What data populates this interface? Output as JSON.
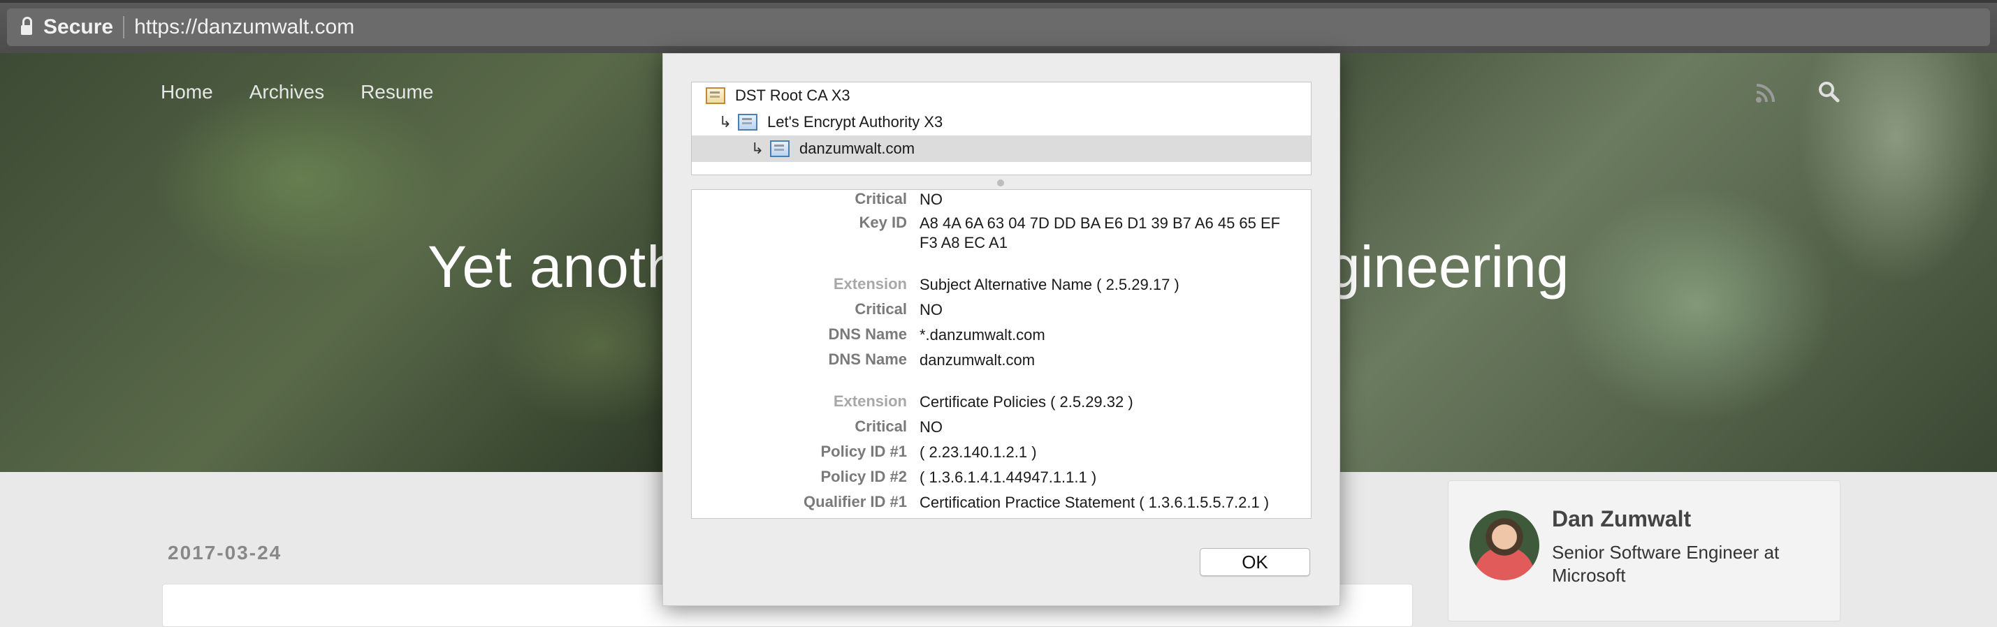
{
  "address_bar": {
    "secure_label": "Secure",
    "url": "https://danzumwalt.com"
  },
  "site": {
    "nav": [
      "Home",
      "Archives",
      "Resume"
    ],
    "headline_left": "Yet anoth",
    "headline_right": "gineering",
    "post_date": "2017-03-24",
    "profile": {
      "name": "Dan Zumwalt",
      "title": "Senior Software Engineer at Microsoft"
    }
  },
  "cert_dialog": {
    "chain": [
      {
        "label": "DST Root CA X3",
        "icon": "cert-root-icon"
      },
      {
        "label": "Let's Encrypt Authority X3",
        "icon": "cert-intermediate-icon"
      },
      {
        "label": "danzumwalt.com",
        "icon": "cert-leaf-icon",
        "selected": true
      }
    ],
    "details": [
      {
        "label": "Critical",
        "value": "NO"
      },
      {
        "label": "Key ID",
        "value": "A8 4A 6A 63 04 7D DD BA E6 D1 39 B7 A6 45 65 EF F3 A8 EC A1"
      },
      {
        "label": "Extension",
        "value": "Subject Alternative Name ( 2.5.29.17 )"
      },
      {
        "label": "Critical",
        "value": "NO"
      },
      {
        "label": "DNS Name",
        "value": "*.danzumwalt.com"
      },
      {
        "label": "DNS Name",
        "value": "danzumwalt.com"
      },
      {
        "label": "Extension",
        "value": "Certificate Policies ( 2.5.29.32 )"
      },
      {
        "label": "Critical",
        "value": "NO"
      },
      {
        "label": "Policy ID #1",
        "value": "( 2.23.140.1.2.1 )"
      },
      {
        "label": "Policy ID #2",
        "value": "( 1.3.6.1.4.1.44947.1.1.1 )"
      },
      {
        "label": "Qualifier ID #1",
        "value": "Certification Practice Statement ( 1.3.6.1.5.5.7.2.1 )"
      }
    ],
    "ok_label": "OK"
  }
}
